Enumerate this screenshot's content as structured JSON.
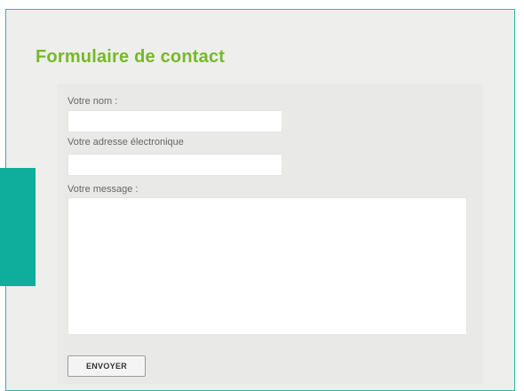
{
  "form": {
    "title": "Formulaire de contact",
    "name_label": "Votre nom :",
    "name_value": "",
    "email_label": "Votre adresse électronique",
    "email_value": "",
    "message_label": "Votre message :",
    "message_value": "",
    "submit_label": "ENVOYER"
  },
  "colors": {
    "accent_green": "#76b82a",
    "teal": "#0fae9c",
    "frame_border": "#2fb7a5",
    "panel_background": "#eeeeec"
  }
}
